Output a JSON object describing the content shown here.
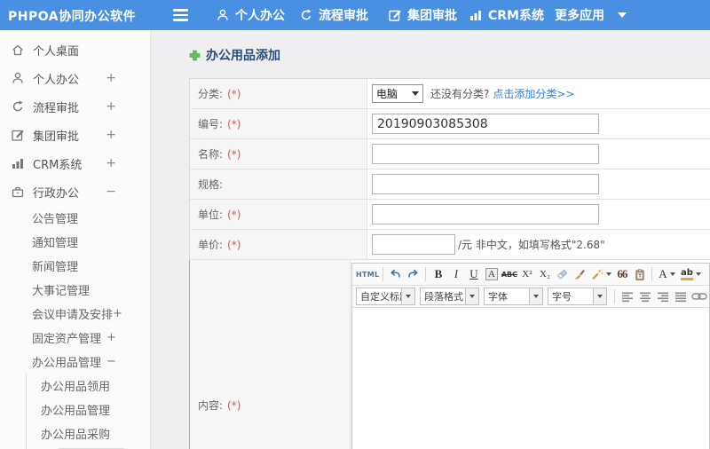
{
  "topbar": {
    "logo": "PHPOA协同办公软件",
    "nav": [
      {
        "label": "个人办公"
      },
      {
        "label": "流程审批"
      },
      {
        "label": "集团审批"
      },
      {
        "label": "CRM系统"
      },
      {
        "label": "更多应用"
      }
    ]
  },
  "sidebar": {
    "items": [
      {
        "label": "个人桌面",
        "toggle": ""
      },
      {
        "label": "个人办公",
        "toggle": "+"
      },
      {
        "label": "流程审批",
        "toggle": "+"
      },
      {
        "label": "集团审批",
        "toggle": "+"
      },
      {
        "label": "CRM系统",
        "toggle": "+"
      },
      {
        "label": "行政办公",
        "toggle": "−"
      },
      {
        "label": "公告管理",
        "toggle": ""
      },
      {
        "label": "通知管理",
        "toggle": ""
      },
      {
        "label": "新闻管理",
        "toggle": ""
      },
      {
        "label": "大事记管理",
        "toggle": ""
      },
      {
        "label": "会议申请及安排",
        "toggle": "+"
      },
      {
        "label": "固定资产管理",
        "toggle": "+"
      },
      {
        "label": "办公用品管理",
        "toggle": "−"
      },
      {
        "label": "办公用品领用",
        "toggle": ""
      },
      {
        "label": "办公用品管理",
        "toggle": ""
      },
      {
        "label": "办公用品采购",
        "toggle": ""
      }
    ]
  },
  "main": {
    "title": "办公用品添加",
    "form": {
      "category": {
        "label": "分类:",
        "required": "(*)",
        "value": "电脑",
        "hint": "还没有分类?",
        "link": "点击添加分类>>"
      },
      "code": {
        "label": "编号:",
        "required": "(*)",
        "value": "20190903085308"
      },
      "name": {
        "label": "名称:",
        "required": "(*)",
        "value": ""
      },
      "spec": {
        "label": "规格:",
        "value": ""
      },
      "unit": {
        "label": "单位:",
        "required": "(*)",
        "value": ""
      },
      "price": {
        "label": "单价:",
        "required": "(*)",
        "value": "",
        "suffix": "/元 非中文，如填写格式\"2.68\""
      },
      "content": {
        "label": "内容:",
        "required": "(*)"
      }
    },
    "editor": {
      "html": "HTML",
      "bold": "B",
      "italic": "I",
      "underline": "U",
      "boxed_a": "A",
      "strike": "ABC",
      "superscript": "X²",
      "subscript": "X₂",
      "quote": "66",
      "font_color": "A",
      "highlight": "ab",
      "selects": [
        {
          "label": "自定义标题"
        },
        {
          "label": "段落格式"
        },
        {
          "label": "字体"
        },
        {
          "label": "字号"
        }
      ]
    }
  },
  "colors": {
    "topbar": "#4a90e2",
    "link": "#2f81d8",
    "required": "#e95252",
    "title": "#2b4d77"
  }
}
